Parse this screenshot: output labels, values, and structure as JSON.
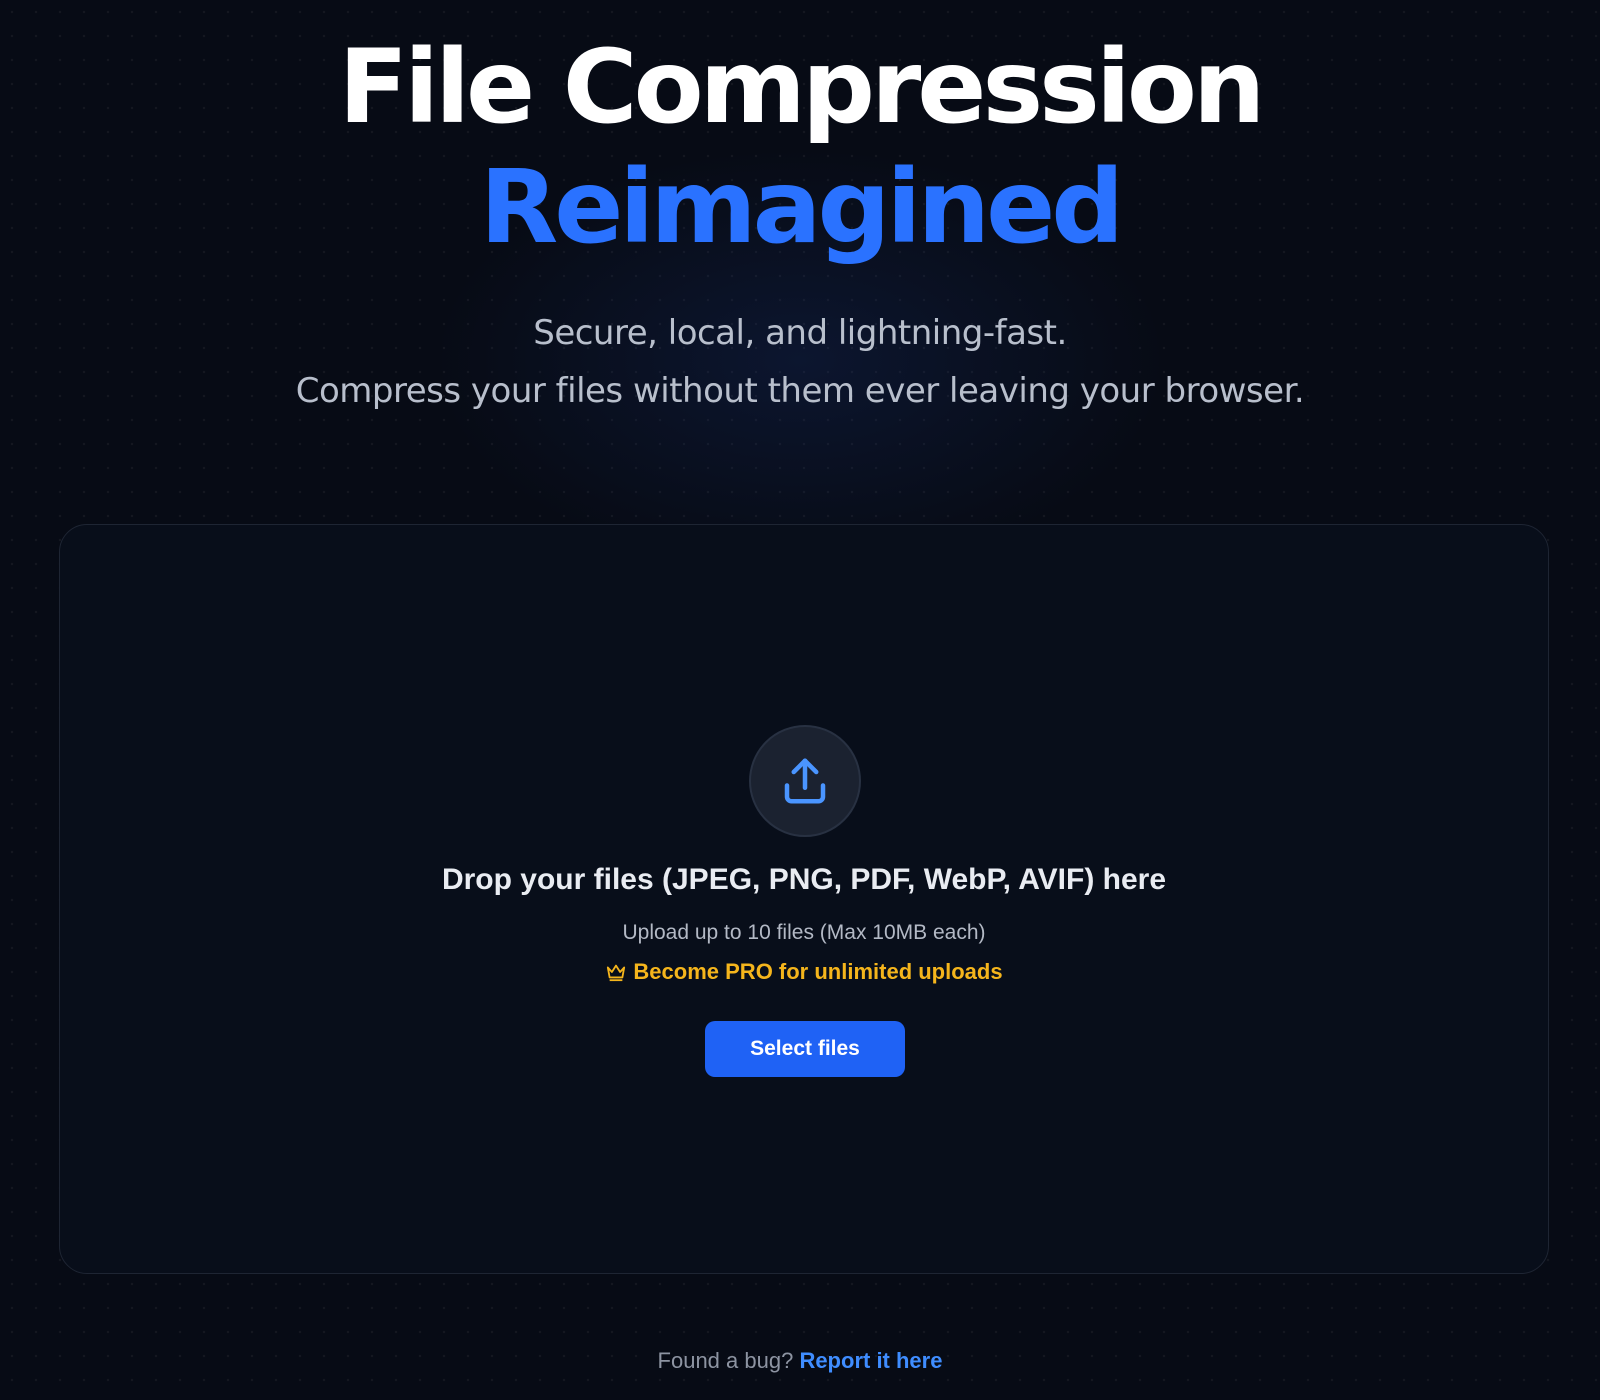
{
  "hero": {
    "title_line_1": "File Compression",
    "title_line_2": "Reimagined",
    "subtitle_line_1": "Secure, local, and lightning-fast.",
    "subtitle_line_2": "Compress your files without them ever leaving your browser."
  },
  "dropzone": {
    "icon": "upload-icon",
    "title": "Drop your files (JPEG, PNG, PDF, WebP, AVIF) here",
    "limit": "Upload up to 10 files (Max 10MB each)",
    "pro_icon": "crown-icon",
    "pro_label": "Become PRO for unlimited uploads",
    "button_label": "Select files"
  },
  "footer": {
    "question": "Found a bug?",
    "link_label": "Report it here"
  },
  "colors": {
    "accent": "#1f62f5",
    "title_accent": "#2a72ff",
    "pro": "#f5b51c",
    "background": "#070b15"
  }
}
